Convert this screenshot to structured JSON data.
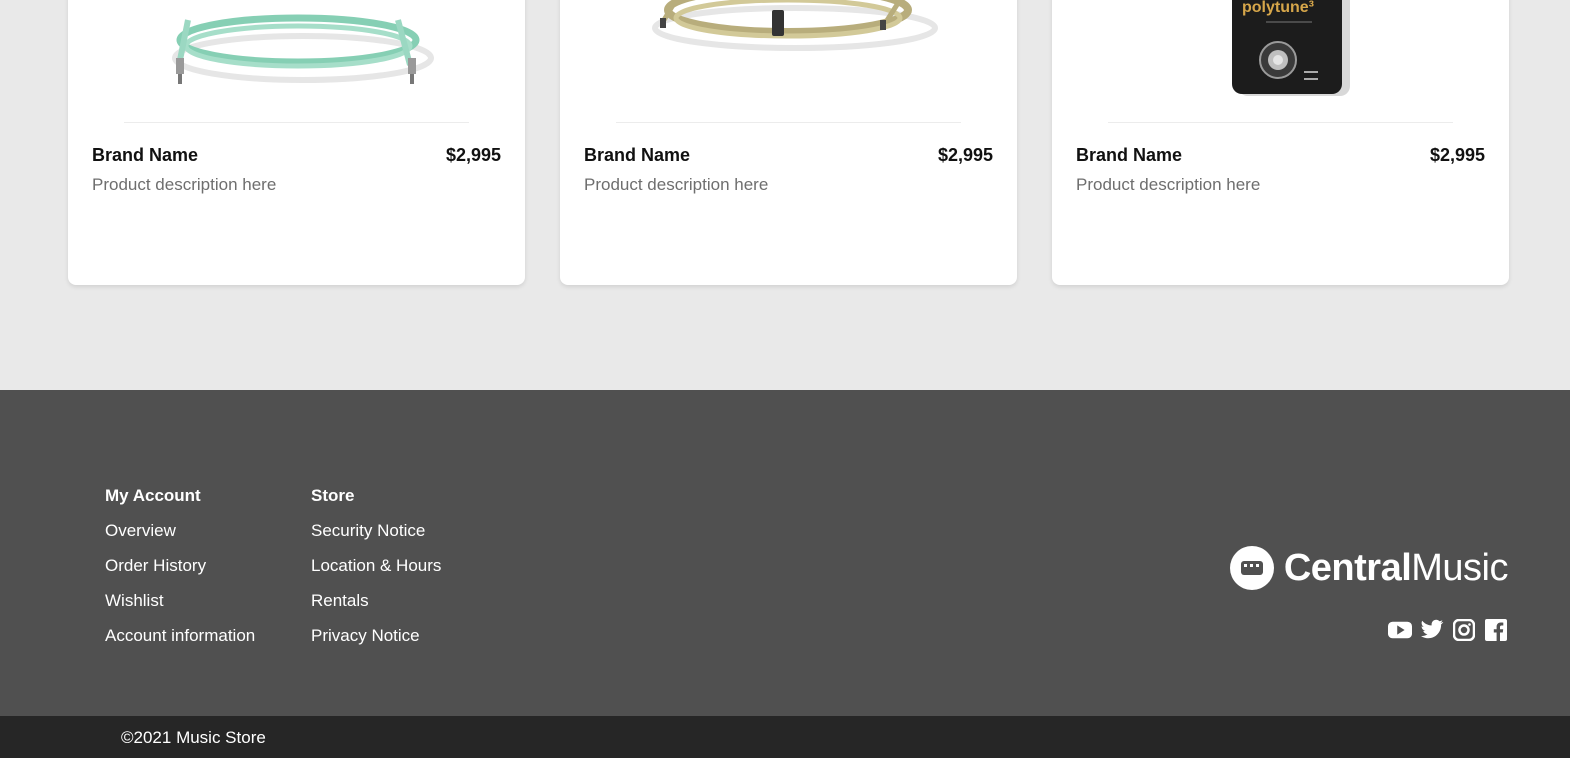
{
  "products": [
    {
      "brand": "Brand Name",
      "price": "$2,995",
      "description": "Product description here",
      "image": "mint-guitar-cable"
    },
    {
      "brand": "Brand Name",
      "price": "$2,995",
      "description": "Product description here",
      "image": "tweed-guitar-cable"
    },
    {
      "brand": "Brand Name",
      "price": "$2,995",
      "description": "Product description here",
      "image": "polytune-pedal",
      "image_text": "polytune³"
    }
  ],
  "footer": {
    "my_account": {
      "heading": "My Account",
      "links": [
        "Overview",
        "Order History",
        "Wishlist",
        "Account information"
      ]
    },
    "store": {
      "heading": "Store",
      "links": [
        "Security Notice",
        "Location & Hours",
        "Rentals",
        "Privacy Notice"
      ]
    },
    "logo": {
      "bold": "Central",
      "regular": "Music"
    },
    "socials": [
      "youtube-icon",
      "twitter-icon",
      "instagram-icon",
      "facebook-icon"
    ]
  },
  "copyright": "©2021 Music Store",
  "colors": {
    "page_bg": "#e9e9e9",
    "footer_bg": "#505050",
    "bottom_bar_bg": "#262626"
  }
}
